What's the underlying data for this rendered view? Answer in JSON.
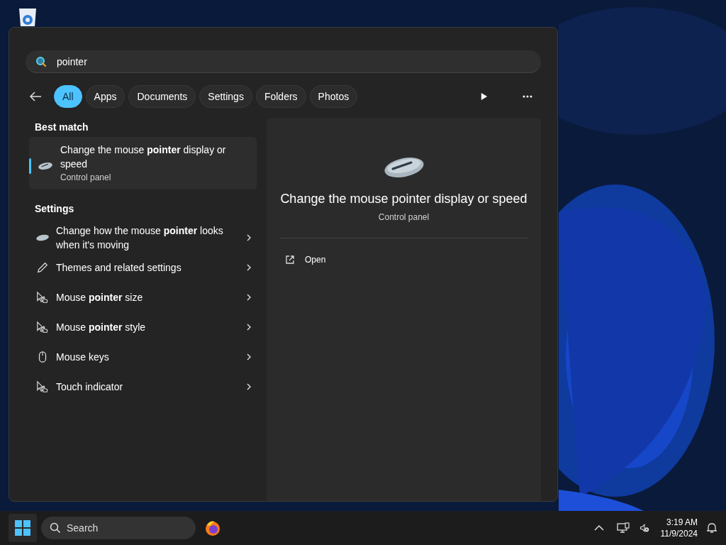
{
  "search": {
    "value": "pointer"
  },
  "filters": [
    {
      "label": "All",
      "selected": true
    },
    {
      "label": "Apps",
      "selected": false
    },
    {
      "label": "Documents",
      "selected": false
    },
    {
      "label": "Settings",
      "selected": false
    },
    {
      "label": "Folders",
      "selected": false
    },
    {
      "label": "Photos",
      "selected": false
    }
  ],
  "best_match": {
    "heading": "Best match",
    "item": {
      "title": "Change the mouse **pointer** display or speed",
      "subtitle": "Control panel",
      "selected": true
    }
  },
  "settings": {
    "heading": "Settings",
    "items": [
      {
        "kind": "mouse",
        "title": "Change how the mouse **pointer** looks when it's moving"
      },
      {
        "kind": "brush",
        "title": "Themes and related settings"
      },
      {
        "kind": "cursor",
        "title": "Mouse **pointer** size"
      },
      {
        "kind": "cursor",
        "title": "Mouse **pointer** style"
      },
      {
        "kind": "mouse-outline",
        "title": "Mouse keys"
      },
      {
        "kind": "cursor",
        "title": "Touch indicator"
      }
    ]
  },
  "preview": {
    "title": "Change the mouse pointer display or speed",
    "subtitle": "Control panel",
    "actions": [
      {
        "label": "Open"
      }
    ]
  },
  "taskbar": {
    "search_placeholder": "Search",
    "time": "3:19 AM",
    "date": "11/9/2024"
  }
}
